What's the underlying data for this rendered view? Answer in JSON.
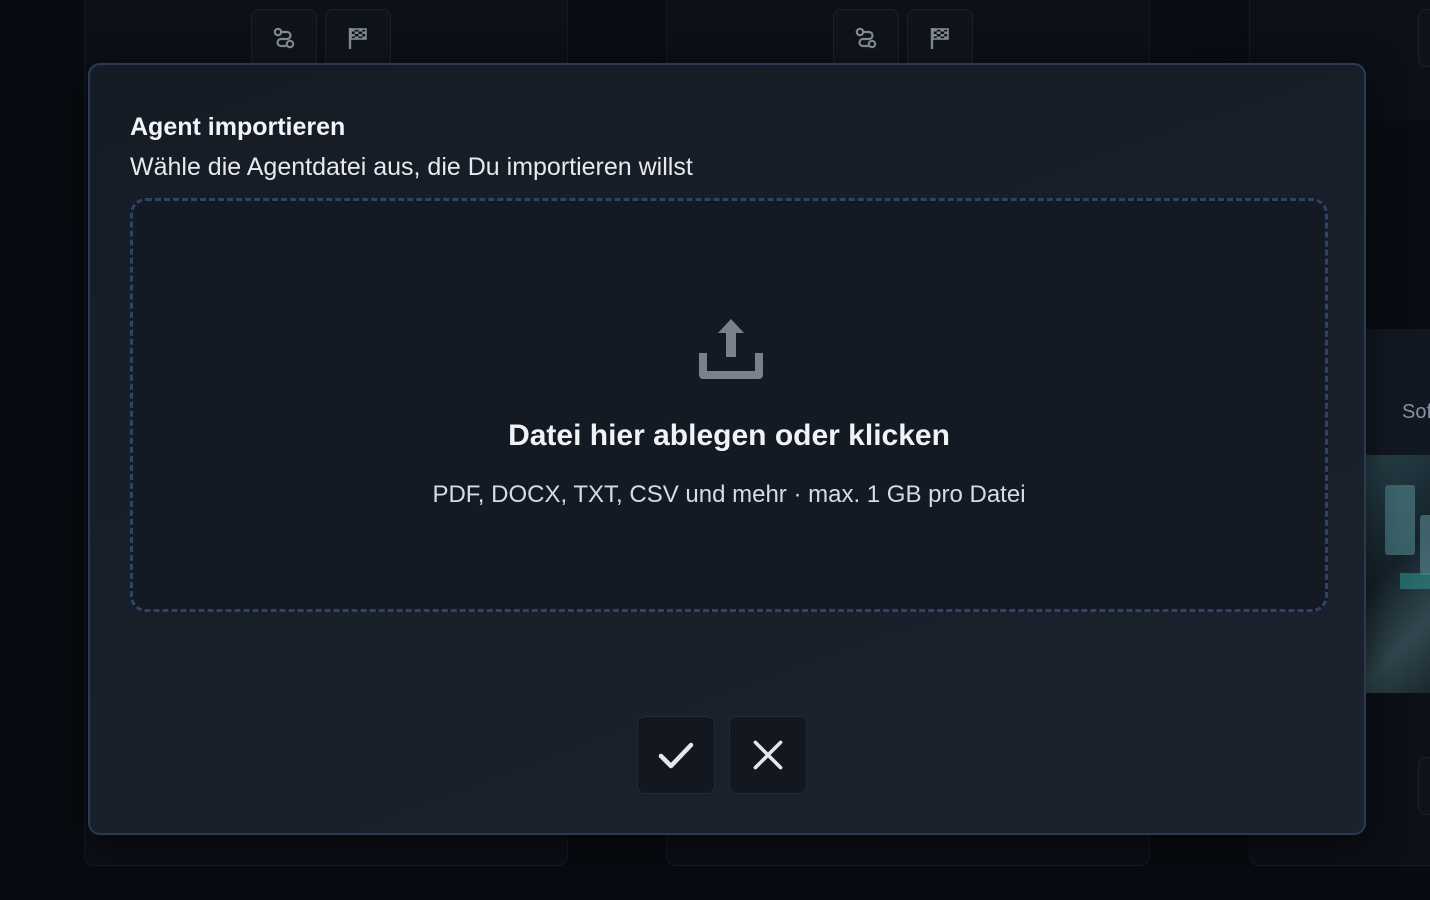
{
  "dialog": {
    "title": "Agent importieren",
    "subtitle": "Wähle die Agentdatei aus, die Du importieren willst",
    "dropzone": {
      "icon": "upload-icon",
      "title": "Datei hier ablegen oder klicken",
      "hint": "PDF, DOCX, TXT, CSV und mehr · max. 1 GB pro Datei"
    },
    "actions": {
      "confirm_icon": "check-icon",
      "cancel_icon": "close-icon"
    }
  },
  "background": {
    "cards": [
      {
        "icons": [
          "route-icon",
          "flag-icon"
        ]
      },
      {
        "icons": [
          "route-icon",
          "flag-icon"
        ]
      }
    ],
    "partial_card_label": "Sof"
  },
  "colors": {
    "modal_border": "#2b3a52",
    "dropzone_border": "#2e4466",
    "icon_gray": "#7b818b"
  }
}
